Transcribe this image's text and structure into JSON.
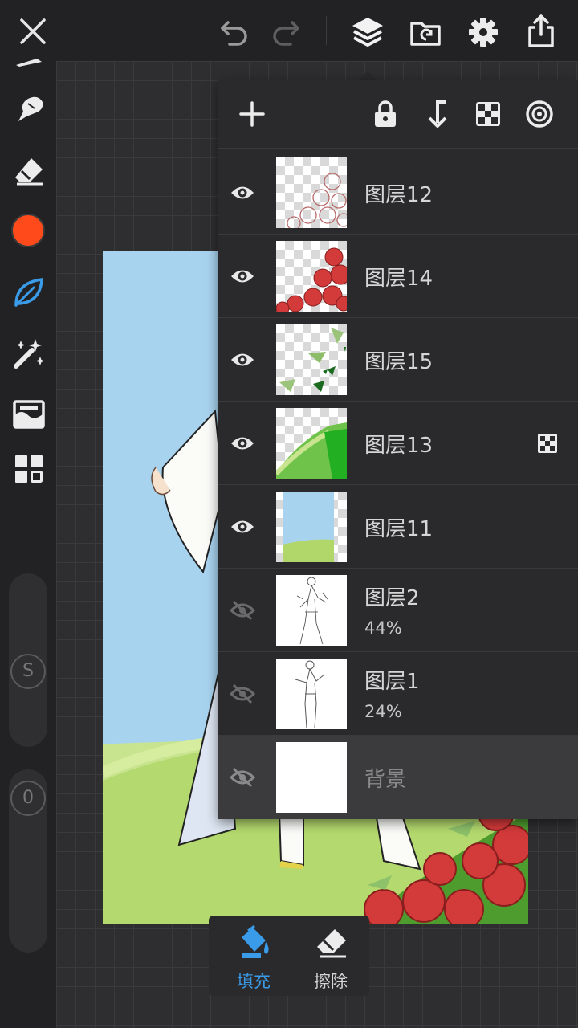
{
  "topbar": {
    "icons": [
      "close-icon",
      "undo-icon",
      "redo-icon",
      "layers-icon",
      "import-icon",
      "settings-icon",
      "share-icon"
    ]
  },
  "sidebar": {
    "tools": [
      "brush-icon",
      "smudge-icon",
      "eraser-icon",
      "color-swatch",
      "leaf-brush-icon",
      "magic-wand-icon",
      "adjust-icon",
      "gallery-icon"
    ],
    "color": "#ff4a1c",
    "size_label": "S",
    "opacity_label": "0"
  },
  "layers_panel": {
    "toolbar_icons": [
      "add-icon",
      "lock-icon",
      "merge-down-icon",
      "alpha-lock-icon",
      "reference-icon"
    ],
    "layers": [
      {
        "name": "图层12",
        "opacity": "",
        "visible": true
      },
      {
        "name": "图层14",
        "opacity": "",
        "visible": true
      },
      {
        "name": "图层15",
        "opacity": "",
        "visible": true
      },
      {
        "name": "图层13",
        "opacity": "",
        "visible": true,
        "alpha_lock": true
      },
      {
        "name": "图层11",
        "opacity": "",
        "visible": true
      },
      {
        "name": "图层2",
        "opacity": "44%",
        "visible": false
      },
      {
        "name": "图层1",
        "opacity": "24%",
        "visible": false
      },
      {
        "name": "背景",
        "opacity": "",
        "visible": false,
        "selected": true
      }
    ]
  },
  "bottom_tools": {
    "fill_label": "填充",
    "erase_label": "擦除"
  },
  "colors": {
    "accent": "#3a9be8",
    "background": "#222224",
    "panel": "#2a2a2c"
  }
}
